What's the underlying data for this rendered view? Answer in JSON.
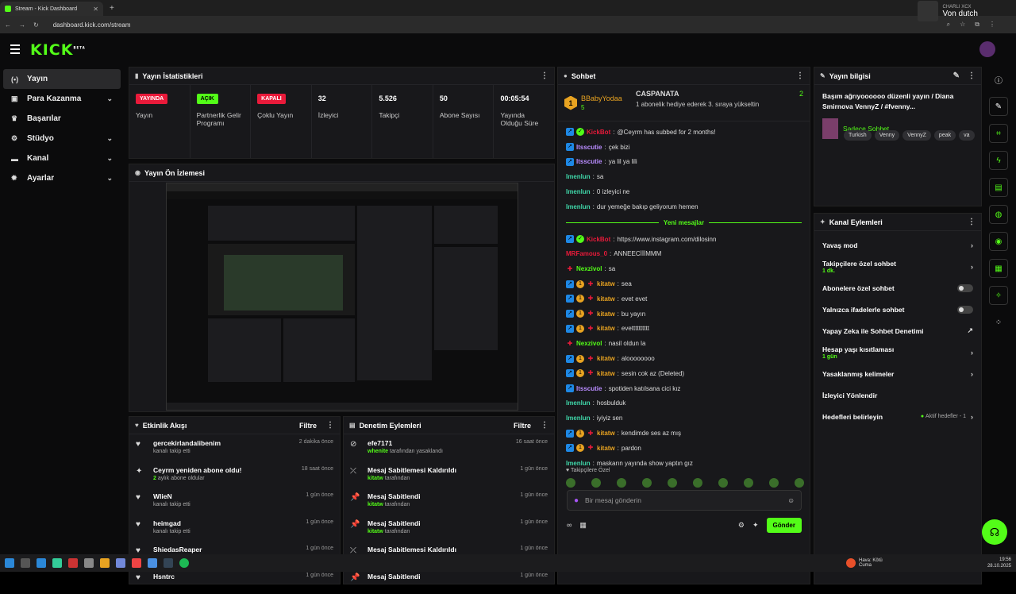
{
  "browser": {
    "tab_title": "Stream - Kick Dashboard",
    "url": "dashboard.kick.com/stream"
  },
  "media": {
    "artist": "CHARLI XCX",
    "song": "Von dutch"
  },
  "brand": {
    "logo": "KICK",
    "beta": "BETA",
    "accent": "#53fc18"
  },
  "sidebar": {
    "items": [
      {
        "label": "Yayın"
      },
      {
        "label": "Para Kazanma"
      },
      {
        "label": "Başarılar"
      },
      {
        "label": "Stüdyo"
      },
      {
        "label": "Kanal"
      },
      {
        "label": "Ayarlar"
      }
    ]
  },
  "stats": {
    "title": "Yayın İstatistikleri",
    "cells": [
      {
        "value": "YAYINDA",
        "label": "Yayın"
      },
      {
        "value": "AÇIK",
        "label": "Partnerlik Gelir Programı"
      },
      {
        "value": "KAPALI",
        "label": "Çoklu Yayın"
      },
      {
        "value": "32",
        "label": "İzleyici"
      },
      {
        "value": "5.526",
        "label": "Takipçi"
      },
      {
        "value": "50",
        "label": "Abone Sayısı"
      },
      {
        "value": "00:05:54",
        "label": "Yayında Olduğu Süre"
      }
    ]
  },
  "preview": {
    "title": "Yayın Ön İzlemesi"
  },
  "activity": {
    "title": "Etkinlik Akışı",
    "filter": "Filtre",
    "items": [
      {
        "name": "gercekirlandalibenim",
        "sub": "kanalı takip etti",
        "time": "2 dakika önce",
        "icon": "heart"
      },
      {
        "name": "Ceyrm yeniden abone oldu!",
        "hl": "2",
        "sub": "aylık abone oldular",
        "time": "18 saat önce",
        "icon": "star"
      },
      {
        "name": "WlieN",
        "sub": "kanalı takip etti",
        "time": "1 gün önce",
        "icon": "heart"
      },
      {
        "name": "heimgad",
        "sub": "kanalı takip etti",
        "time": "1 gün önce",
        "icon": "heart"
      },
      {
        "name": "ShiedasReaper",
        "sub": "kanalı takip etti",
        "time": "1 gün önce",
        "icon": "heart"
      },
      {
        "name": "Hsntrc",
        "sub": "",
        "time": "1 gün önce",
        "icon": "heart"
      }
    ]
  },
  "moderation": {
    "title": "Denetim Eylemleri",
    "filter": "Filtre",
    "items": [
      {
        "name": "efe7171",
        "hl": "whenite",
        "sub": "tarafından yasaklandı",
        "time": "16 saat önce",
        "icon": "ban"
      },
      {
        "name": "Mesaj Sabitlemesi Kaldırıldı",
        "hl": "kitatw",
        "sub": "tarafından",
        "time": "1 gün önce",
        "icon": "unpin"
      },
      {
        "name": "Mesaj Sabitlendi",
        "hl": "kitatw",
        "sub": "tarafından",
        "time": "1 gün önce",
        "icon": "pin"
      },
      {
        "name": "Mesaj Sabitlendi",
        "hl": "kitatw",
        "sub": "tarafından",
        "time": "1 gün önce",
        "icon": "pin"
      },
      {
        "name": "Mesaj Sabitlemesi Kaldırıldı",
        "hl": "lForlon",
        "sub": "tarafından",
        "time": "1 gün önce",
        "icon": "unpin"
      },
      {
        "name": "Mesaj Sabitlendi",
        "hl": "",
        "sub": "",
        "time": "1 gün önce",
        "icon": "pin"
      }
    ]
  },
  "chat": {
    "title": "Sohbet",
    "top1": {
      "rank": "1",
      "name": "BBabyYodaa",
      "count": "5"
    },
    "top2": {
      "name": "CASPANATA",
      "count": "2",
      "note": "1 abonelik hediye ederek 3. sıraya yükseltin"
    },
    "messages": [
      {
        "user": "KickBot",
        "color": "#e91a3a",
        "text": "@Ceyrm has subbed for 2 months!",
        "badges": [
          "b",
          "g"
        ]
      },
      {
        "user": "Itsscutie",
        "color": "#b98cff",
        "text": "çek bizi",
        "badges": [
          "b"
        ]
      },
      {
        "user": "Itsscutie",
        "color": "#b98cff",
        "text": "ya lil ya lili",
        "badges": [
          "b"
        ]
      },
      {
        "user": "Imenlun",
        "color": "#3fd6a8",
        "text": "sa",
        "badges": []
      },
      {
        "user": "Imenlun",
        "color": "#3fd6a8",
        "text": "0 izleyici ne",
        "badges": []
      },
      {
        "user": "Imenlun",
        "color": "#3fd6a8",
        "text": "dur yemeğe bakıp geliyorum hemen",
        "badges": []
      }
    ],
    "new_label": "Yeni mesajlar",
    "messages2": [
      {
        "user": "KickBot",
        "color": "#e91a3a",
        "text": "https://www.instagram.com/dilosinn",
        "badges": [
          "b",
          "g"
        ]
      },
      {
        "user": "MRFamous_0",
        "color": "#e91a3a",
        "text": "ANNEECİİİMMM",
        "badges": []
      },
      {
        "user": "Nexzivol",
        "color": "#53fc18",
        "text": "sa",
        "badges": [
          "r"
        ]
      },
      {
        "user": "kitatw",
        "color": "#e8a321",
        "text": "sea",
        "badges": [
          "b",
          "y",
          "r"
        ]
      },
      {
        "user": "kitatw",
        "color": "#e8a321",
        "text": "evet evet",
        "badges": [
          "b",
          "y",
          "r"
        ]
      },
      {
        "user": "kitatw",
        "color": "#e8a321",
        "text": "bu yayın",
        "badges": [
          "b",
          "y",
          "r"
        ]
      },
      {
        "user": "kitatw",
        "color": "#e8a321",
        "text": "evetttttttttt",
        "badges": [
          "b",
          "y",
          "r"
        ]
      },
      {
        "user": "Nexzivol",
        "color": "#53fc18",
        "text": "nasil oldun la",
        "badges": [
          "r"
        ]
      },
      {
        "user": "kitatw",
        "color": "#e8a321",
        "text": "aloooooooo",
        "badges": [
          "b",
          "y",
          "r"
        ]
      },
      {
        "user": "kitatw",
        "color": "#e8a321",
        "text": "sesin cok az (Deleted)",
        "badges": [
          "b",
          "y",
          "r"
        ]
      },
      {
        "user": "Itsscutie",
        "color": "#b98cff",
        "text": "spotiden katılsana cici kız",
        "badges": [
          "b"
        ]
      },
      {
        "user": "Imenlun",
        "color": "#3fd6a8",
        "text": "hosbulduk",
        "badges": []
      },
      {
        "user": "Imenlun",
        "color": "#3fd6a8",
        "text": "iyiyiz sen",
        "badges": []
      },
      {
        "user": "kitatw",
        "color": "#e8a321",
        "text": "kendimde ses az mış",
        "badges": [
          "b",
          "y",
          "r"
        ]
      },
      {
        "user": "kitatw",
        "color": "#e8a321",
        "text": "pardon",
        "badges": [
          "b",
          "y",
          "r"
        ]
      },
      {
        "user": "Imenlun",
        "color": "#3fd6a8",
        "text": "maskarın yayında show yaptın gız",
        "badges": []
      }
    ],
    "emote_label": "Takipçilere Özel",
    "placeholder": "Bir mesaj gönderin",
    "send": "Gönder"
  },
  "info": {
    "title_label": "Yayın bilgisi",
    "stream_title": "Başım ağrıyoooooo düzenli yayın / Diana Smirnova VennyZ / #fvenny...",
    "category": "Sadece Sohbet",
    "tags": [
      "Turkish",
      "Venny",
      "VennyZ",
      "peak",
      "va"
    ]
  },
  "actions": {
    "title": "Kanal Eylemleri",
    "items": [
      {
        "label": "Yavaş mod",
        "sub": "",
        "ctl": "chev"
      },
      {
        "label": "Takipçilere özel sohbet",
        "sub": "1 dk.",
        "ctl": "chev"
      },
      {
        "label": "Abonelere özel sohbet",
        "sub": "",
        "ctl": "toggle"
      },
      {
        "label": "Yalnızca ifadelerle sohbet",
        "sub": "",
        "ctl": "toggle"
      },
      {
        "label": "Yapay Zeka ile Sohbet Denetimi",
        "sub": "",
        "ctl": "ext"
      },
      {
        "label": "Hesap yaşı kısıtlaması",
        "sub": "1 gün",
        "ctl": "chev"
      },
      {
        "label": "Yasaklanmış kelimeler",
        "sub": "",
        "ctl": "chev"
      },
      {
        "label": "İzleyici Yönlendir",
        "sub": "",
        "ctl": "none"
      },
      {
        "label": "Hedefleri belirleyin",
        "sub": "",
        "ctl": "goal",
        "hint": "Aktif hedefler - 1"
      }
    ]
  },
  "taskbar": {
    "weather": "Hava: Kötü",
    "weather_sub": "Cuma",
    "time": "19:56",
    "date": "28.10.2025"
  }
}
